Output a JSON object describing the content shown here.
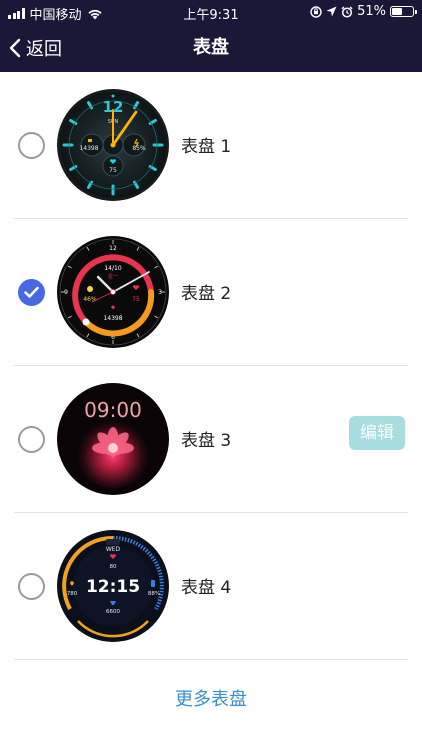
{
  "status_bar": {
    "carrier": "中国移动",
    "time": "上午9:31",
    "battery": "51%",
    "battery_level": 0.51
  },
  "nav": {
    "back_label": "返回",
    "title": "表盘"
  },
  "faces": [
    {
      "label": "表盘 1",
      "selected": false,
      "text": {
        "hour12": "12",
        "sun": "SUN",
        "steps": "14398",
        "battery": "85%",
        "heart": "75"
      }
    },
    {
      "label": "表盘 2",
      "selected": true,
      "text": {
        "n12": "12",
        "n3": "3",
        "n6": "6",
        "n9": "9",
        "date": "14/10",
        "day": "星一",
        "battery": "46%",
        "heart": "75",
        "steps": "14398"
      }
    },
    {
      "label": "表盘 3",
      "selected": false,
      "edit_label": "编辑",
      "text": {
        "time": "09:00"
      }
    },
    {
      "label": "表盘 4",
      "selected": false,
      "text": {
        "weekday": "WED",
        "heart": "80",
        "time": "12:15",
        "calories": "780",
        "battery": "88%",
        "steps": "6600"
      }
    }
  ],
  "more_label": "更多表盘",
  "colors": {
    "header_bg": "#1a1836",
    "selected": "#4768e4",
    "edit_btn": "#a8dde0",
    "more_link": "#3a8fd0"
  }
}
